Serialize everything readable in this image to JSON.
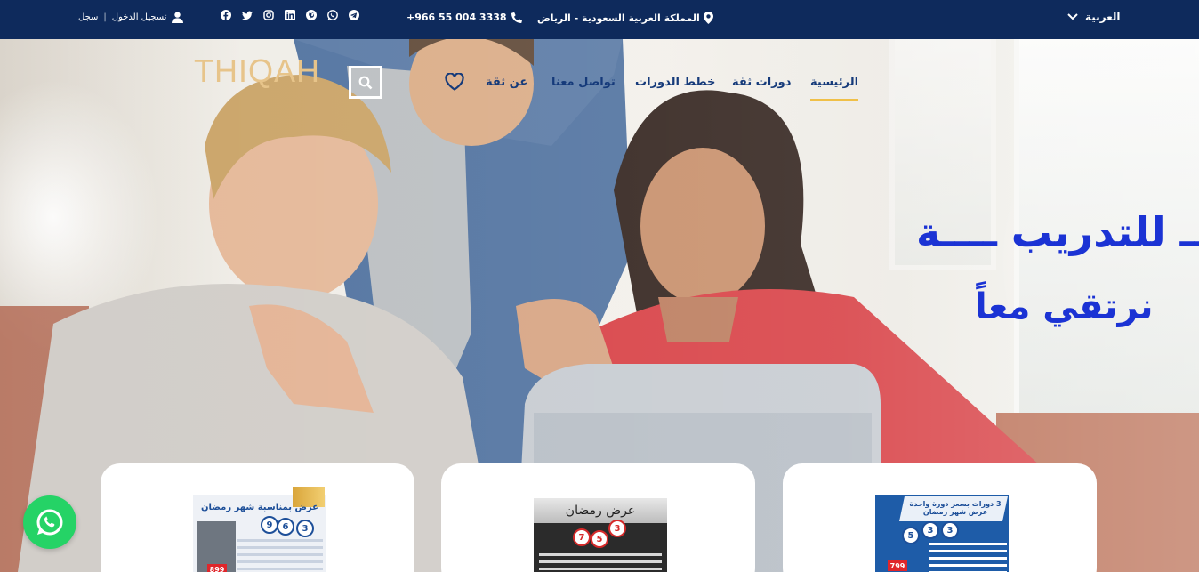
{
  "topbar": {
    "language": "العربية",
    "location": "المملكة العربية السعودية - الرياض",
    "phone": "+966 55 004 3338",
    "login": "تسجيل الدخول",
    "register": "سجل",
    "socials": [
      "telegram-icon",
      "whatsapp-icon",
      "pinterest-icon",
      "linkedin-icon",
      "instagram-icon",
      "twitter-icon",
      "facebook-icon"
    ]
  },
  "header": {
    "logo": "THIQAH",
    "nav": [
      "الرئيسية",
      "دورات ثقة",
      "خطط الدورات",
      "تواصل معنا",
      "عن ثقة"
    ],
    "active_nav": "الرئيسية"
  },
  "hero": {
    "headline": "ــ للتدريب ــــة",
    "subline": "نرتقي معاً"
  },
  "cards": [
    {
      "poster_title": "عرض بمناسبة شهر رمضان",
      "numbers": [
        "9",
        "6",
        "3"
      ],
      "price": "899"
    },
    {
      "poster_title": "عرض رمضان",
      "numbers": [
        "3",
        "5",
        "7"
      ],
      "price": ""
    },
    {
      "poster_title": "3 دورات بسعر دورة واحدة عرض شهر رمضان",
      "numbers": [
        "5",
        "3",
        "3"
      ],
      "price": "799"
    }
  ],
  "colors": {
    "topbar": "#0e2a5c",
    "nav_text": "#153a7a",
    "active_underline": "#f0c048",
    "hero_text": "#1b33d4",
    "logo": "#e7c48a",
    "whatsapp": "#25d366"
  }
}
